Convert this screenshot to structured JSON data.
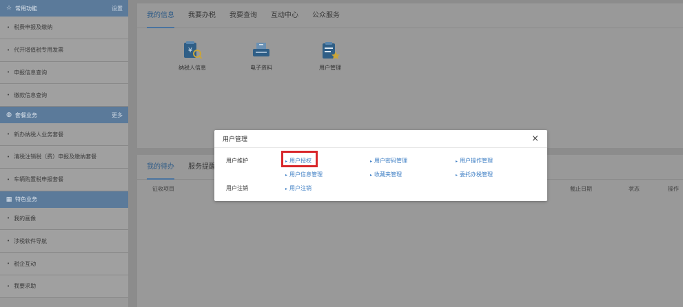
{
  "sidebar": {
    "sections": [
      {
        "title": "常用功能",
        "link": "设置",
        "icon": "star-icon",
        "items": [
          "税费申报及缴纳",
          "代开增值税专用发票",
          "申报信息查询",
          "缴款信息查询"
        ]
      },
      {
        "title": "套餐业务",
        "link": "更多",
        "icon": "package-icon",
        "items": [
          "新办纳税人业务套餐",
          "清税注销税（费）申报及缴纳套餐",
          "车辆购置税申报套餐"
        ]
      },
      {
        "title": "特色业务",
        "link": "",
        "icon": "grid-icon",
        "items": [
          "我的画像",
          "涉税软件导航",
          "税企互动",
          "我要求助"
        ]
      }
    ]
  },
  "main": {
    "tabs": [
      "我的信息",
      "我要办税",
      "我要查询",
      "互动中心",
      "公众服务"
    ],
    "apps": [
      {
        "label": "纳税人信息",
        "icon": "taxpayer-info-icon"
      },
      {
        "label": "电子资料",
        "icon": "e-document-icon"
      },
      {
        "label": "用户管理",
        "icon": "user-management-icon"
      }
    ],
    "bottom_tabs": [
      "我的待办",
      "服务提醒"
    ],
    "table_headers": {
      "col1": "征收项目",
      "col2": "截止日期",
      "col3": "状态",
      "col4": "操作"
    }
  },
  "modal": {
    "title": "用户管理",
    "close": "×",
    "row1_label": "用户维护",
    "row2_label": "用户注销",
    "links": {
      "auth": "用户授权",
      "password": "用户密码管理",
      "operation": "用户操作管理",
      "info": "用户信息管理",
      "favorites": "收藏夹管理",
      "delegate": "委托办税管理",
      "cancel": "用户注销"
    }
  },
  "colors": {
    "sidebar_header": "#5b7a9a",
    "link": "#3f7fc4",
    "highlight": "#d8262a",
    "overlay": "#8c8c8c"
  }
}
